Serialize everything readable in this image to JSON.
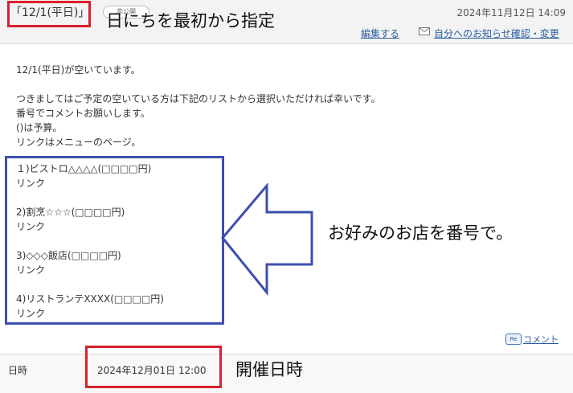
{
  "header": {
    "title": "「12/1(平日)」",
    "visibility_badge": "非公開",
    "timestamp": "2024年11月12日 14:09",
    "edit_link": "編集する",
    "notify_link": "自分へのお知らせ確認・変更"
  },
  "annotations": {
    "title_note": "日にちを最初から指定",
    "list_note": "お好みのお店を番号で。",
    "date_note": "開催日時"
  },
  "body": {
    "lines": [
      "12/1(平日)が空いています。",
      "つきましてはご予定の空いている方は下記のリストから選択いただければ幸いです。",
      "番号でコメントお願いします。",
      "()は予算。",
      "リンクはメニューのページ。"
    ]
  },
  "list": {
    "items": [
      {
        "name": "１)ビストロ△△△△(□□□□円)",
        "link": "リンク"
      },
      {
        "name": "2)割烹☆☆☆(□□□□円)",
        "link": "リンク"
      },
      {
        "name": "3)◇◇◇飯店(□□□□円)",
        "link": "リンク"
      },
      {
        "name": "4)リストランテXXXX(□□□□円)",
        "link": "リンク"
      }
    ]
  },
  "comment": {
    "icon_label": "Re",
    "label": "コメント"
  },
  "event_row": {
    "label": "日時",
    "value": "2024年12月01日 12:00"
  },
  "colors": {
    "highlight_red": "#d8212f",
    "highlight_blue": "#3d4fb1",
    "link_blue": "#2a5d9f"
  }
}
